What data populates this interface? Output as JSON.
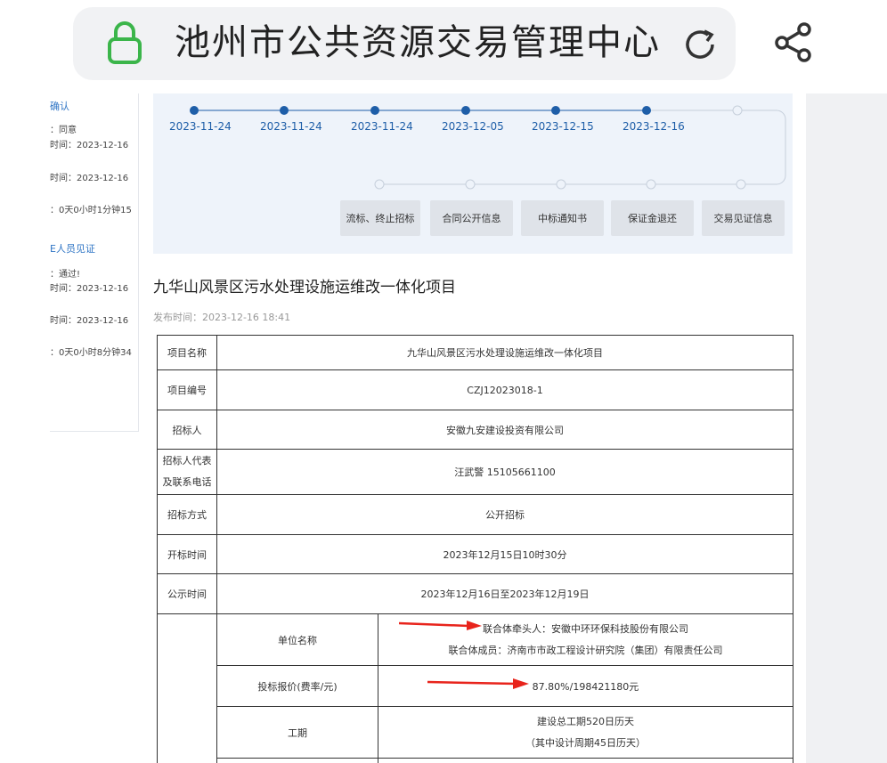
{
  "browser": {
    "site_title": "池州市公共资源交易管理中心",
    "icons": {
      "lock": "lock-icon",
      "reload": "reload-icon",
      "share": "share-icon"
    },
    "accent_green": "#3bb54a"
  },
  "sidebar": {
    "items": [
      "确认",
      "：同意",
      "时间：2023-12-16",
      "时间：2023-12-16",
      "：0天0小时1分钟15",
      "E人员见证",
      "：通过!",
      "时间：2023-12-16",
      "时间：2023-12-16",
      "：0天0小时8分钟34"
    ]
  },
  "timeline": {
    "dates": [
      "2023-11-24",
      "2023-11-24",
      "2023-11-24",
      "2023-12-05",
      "2023-12-15",
      "2023-12-16"
    ],
    "steps": [
      "流标、终止招标",
      "合同公开信息",
      "中标通知书",
      "保证金退还",
      "交易见证信息"
    ],
    "colors": {
      "done": "#1e5ea8",
      "pending_line": "#c6cfdb"
    }
  },
  "article": {
    "title": "九华山风景区污水处理设施运维改一体化项目",
    "publish_label": "发布时间：",
    "publish_time": "2023-12-16 18:41"
  },
  "table": {
    "rows": {
      "project_name": {
        "label": "项目名称",
        "value": "九华山风景区污水处理设施运维改一体化项目"
      },
      "project_no": {
        "label": "项目编号",
        "value": "CZJ12023018-1"
      },
      "tenderer": {
        "label": "招标人",
        "value": "安徽九安建设投资有限公司"
      },
      "rep_label_line1": "招标人代表",
      "rep_label_line2": "及联系电话",
      "rep_value": "汪武警 15105661100",
      "method": {
        "label": "招标方式",
        "value": "公开招标"
      },
      "open_time": {
        "label": "开标时间",
        "value": "2023年12月15日10时30分"
      },
      "notice_period": {
        "label": "公示时间",
        "value": "2023年12月16日至2023年12月19日"
      }
    },
    "winner": {
      "unit_label": "单位名称",
      "unit_lead": "联合体牵头人：安徽中环环保科技股份有限公司",
      "unit_member": "联合体成员：济南市市政工程设计研究院（集团）有限责任公司",
      "bid_label": "投标报价(费率/元)",
      "bid_value": "87.80%/198421180元",
      "period_label": "工期",
      "period_line1": "建设总工期520日历天",
      "period_line2": "（其中设计周期45日历天）"
    },
    "arrow_color": "#e8241c"
  }
}
